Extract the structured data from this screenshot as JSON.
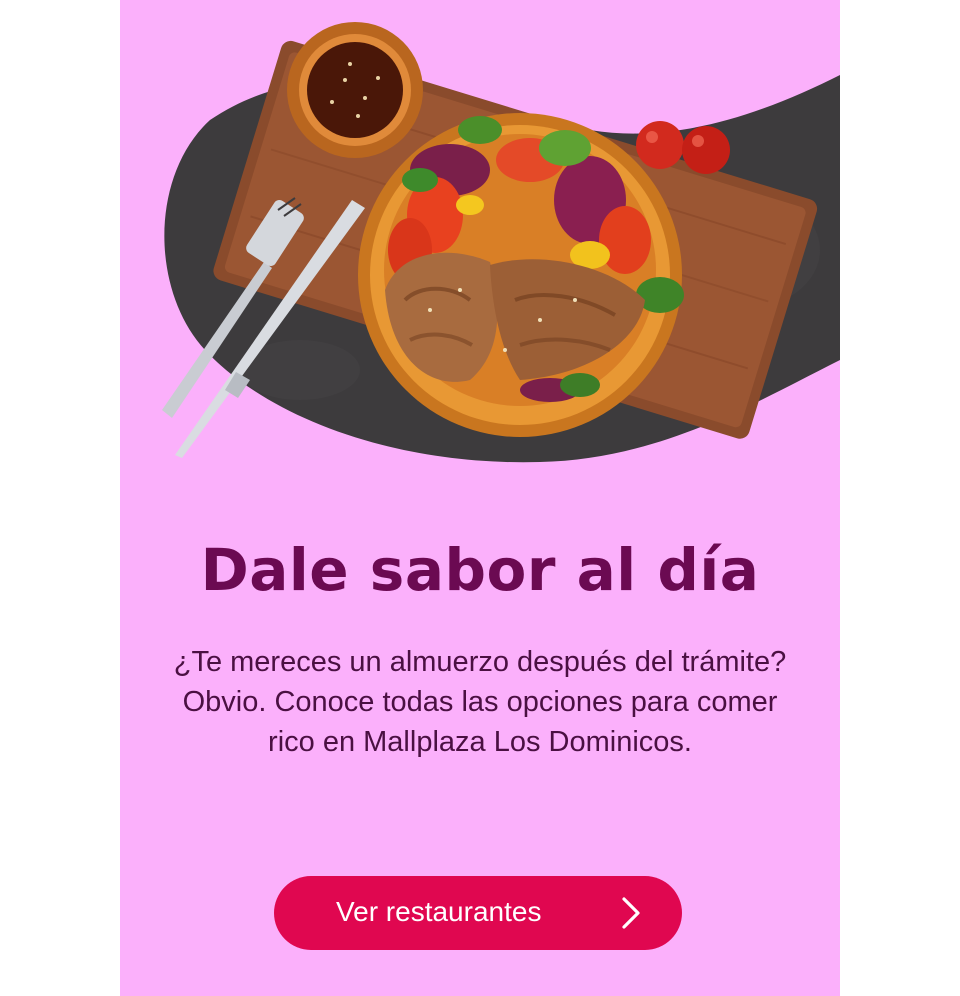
{
  "promo": {
    "headline": "Dale sabor al día",
    "body": "¿Te mereces un almuerzo después del trámite? Obvio. Conoce todas las opciones para comer rico en Mallplaza Los Dominicos.",
    "cta_label": "Ver restaurantes",
    "cta_icon": "chevron-right-icon"
  },
  "colors": {
    "background": "#fbb0fb",
    "headline": "#6b0a52",
    "body_text": "#4a1042",
    "cta": "#e00750",
    "cta_text": "#ffffff"
  }
}
